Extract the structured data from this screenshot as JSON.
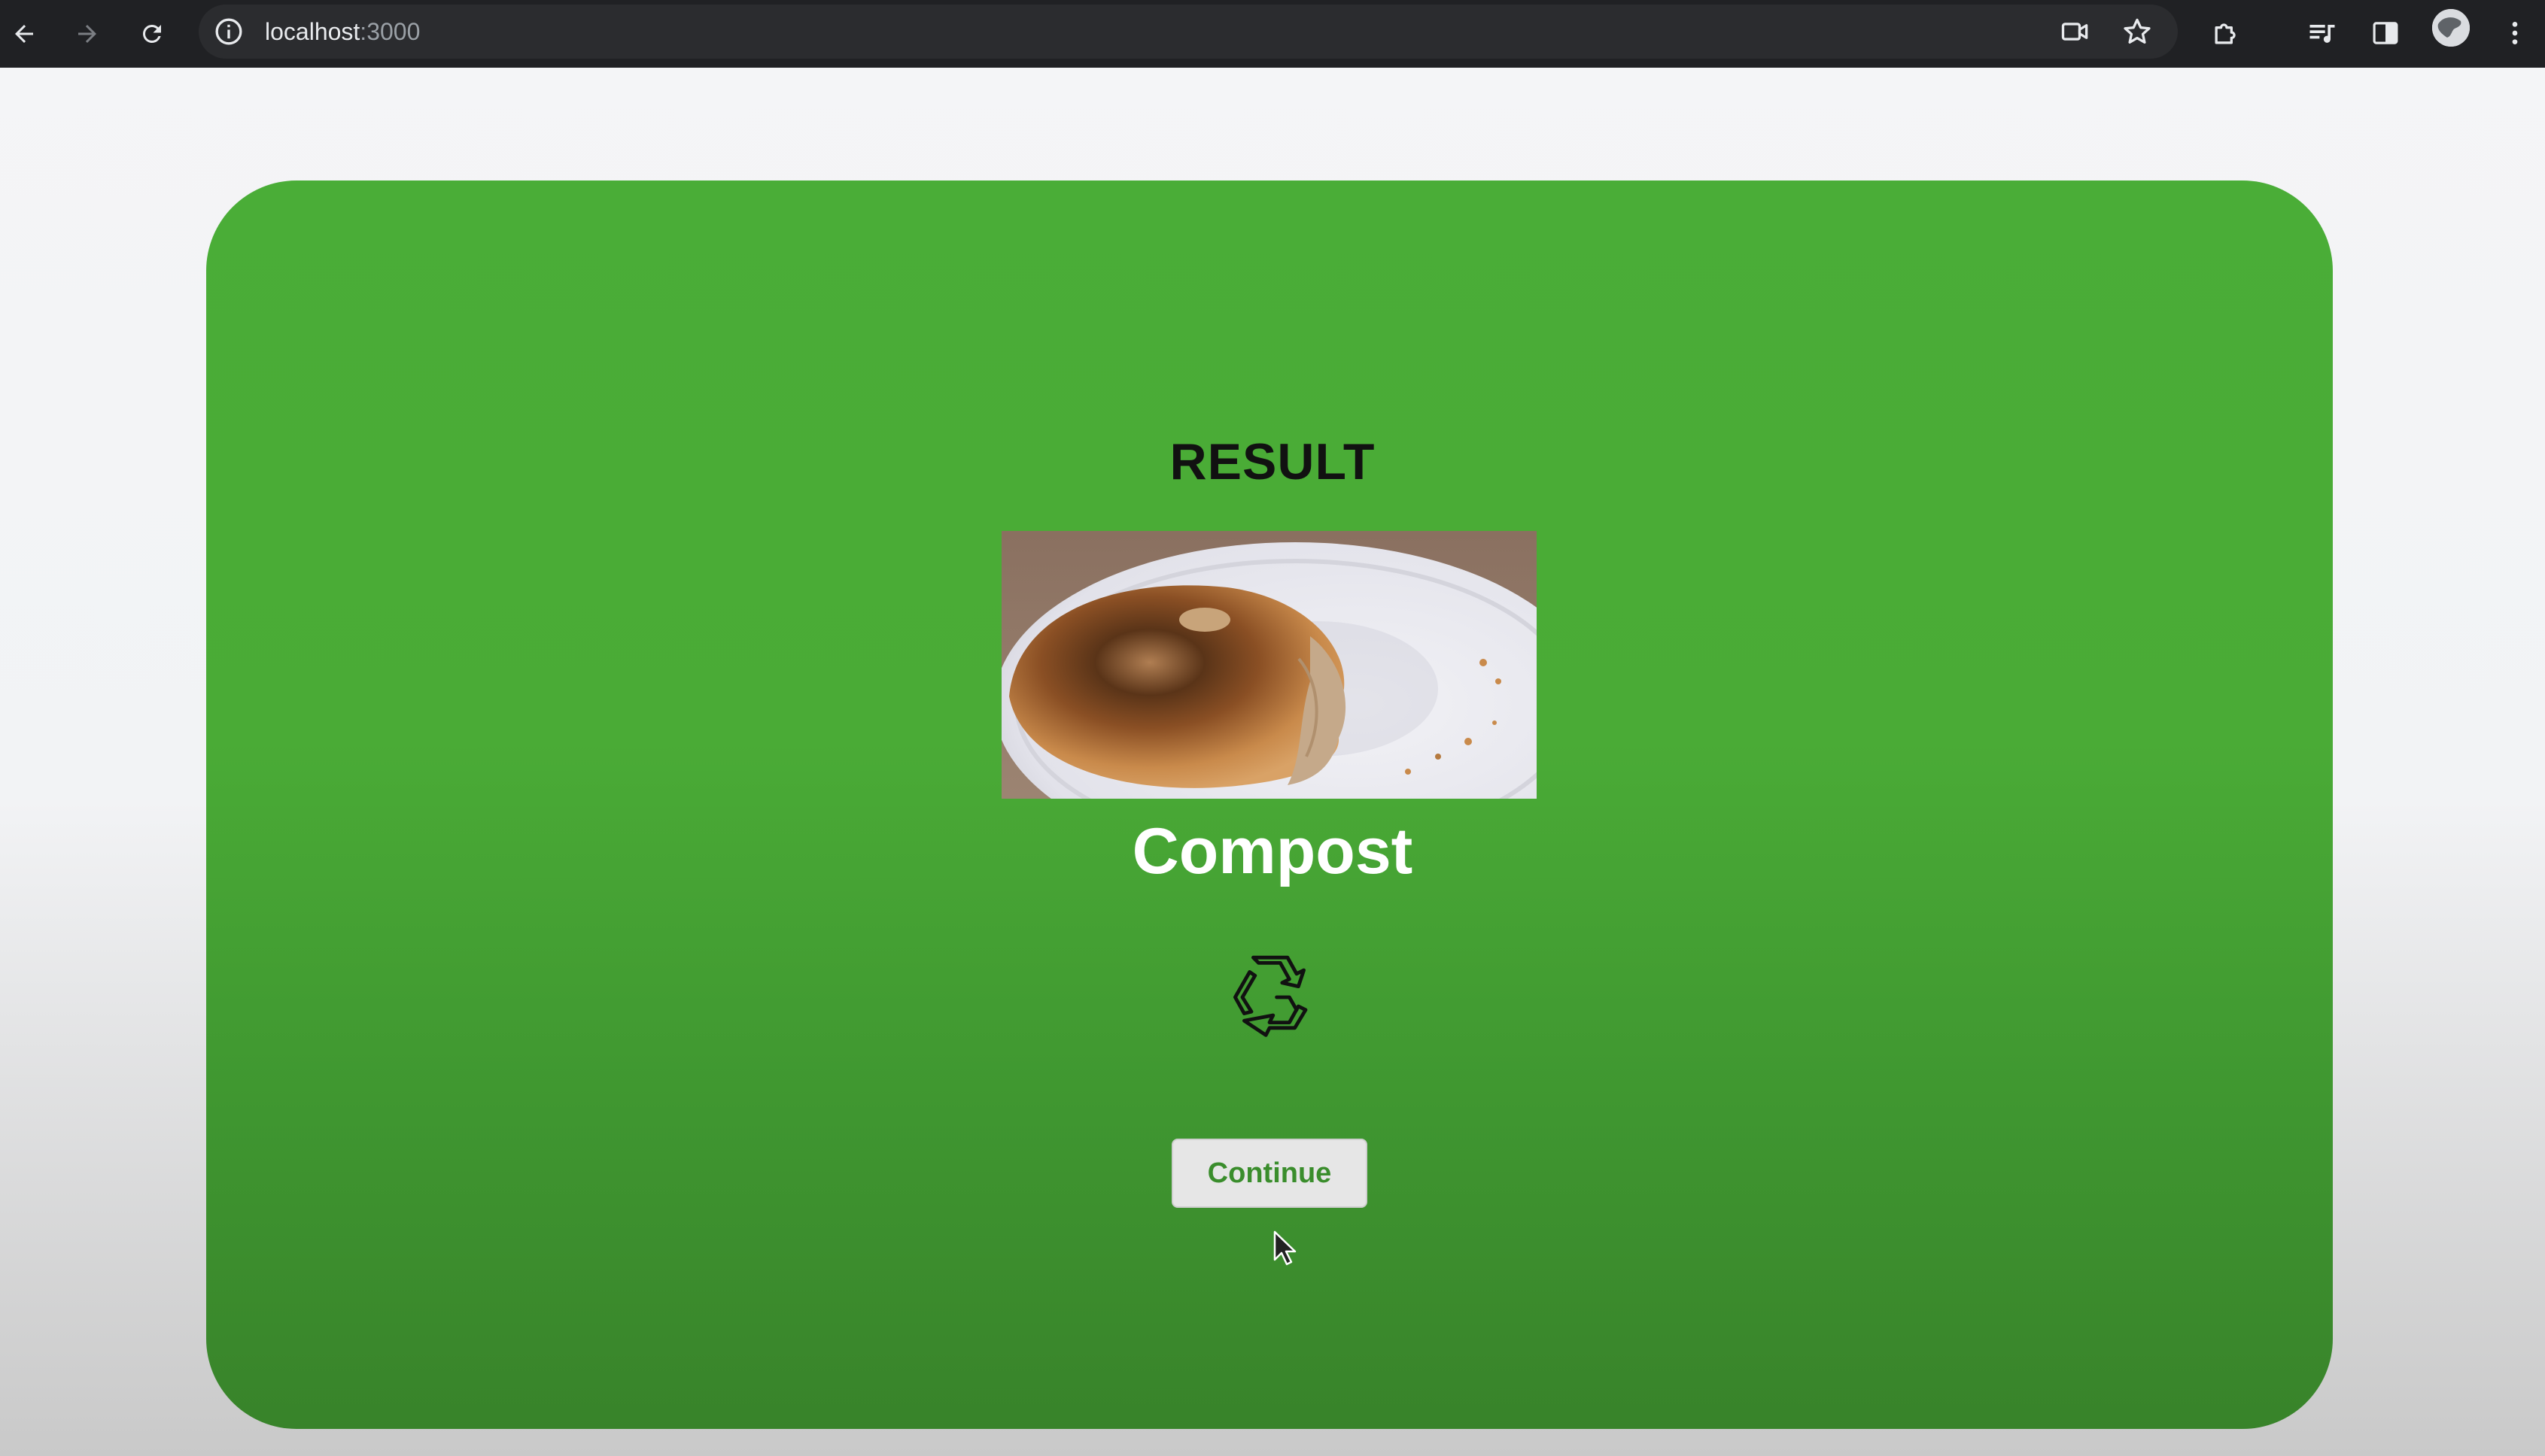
{
  "browser": {
    "url_host": "localhost",
    "url_port": ":3000"
  },
  "result": {
    "heading": "RESULT",
    "category": "Compost",
    "continue_label": "Continue",
    "icon": "recycle-icon",
    "image": "half-eaten toasted bagel on a white paper plate"
  },
  "colors": {
    "card_green": "#4aad37",
    "button_text": "#3a8d2c",
    "button_bg": "#e6e6e6"
  }
}
